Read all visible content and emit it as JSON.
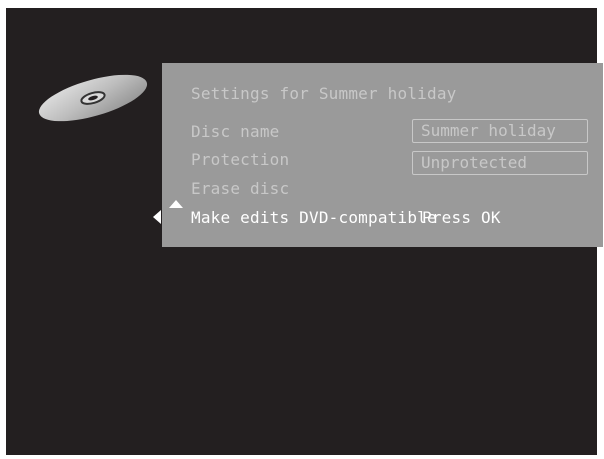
{
  "panel": {
    "title": "Settings for Summer holiday",
    "rows": [
      {
        "label": "Disc name",
        "value": "Summer holiday"
      },
      {
        "label": "Protection",
        "value": "Unprotected"
      },
      {
        "label": "Erase disc"
      },
      {
        "label": "Make edits DVD-compatible",
        "action": "Press OK"
      }
    ]
  },
  "icons": {
    "disc": "disc-icon",
    "nav_up": "arrow-up-icon",
    "nav_left": "arrow-left-icon"
  },
  "colors": {
    "screen_bg": "#231f20",
    "panel_bg": "#9a9a9a",
    "inactive_text": "#c8c8c8",
    "active_text": "#ffffff"
  }
}
